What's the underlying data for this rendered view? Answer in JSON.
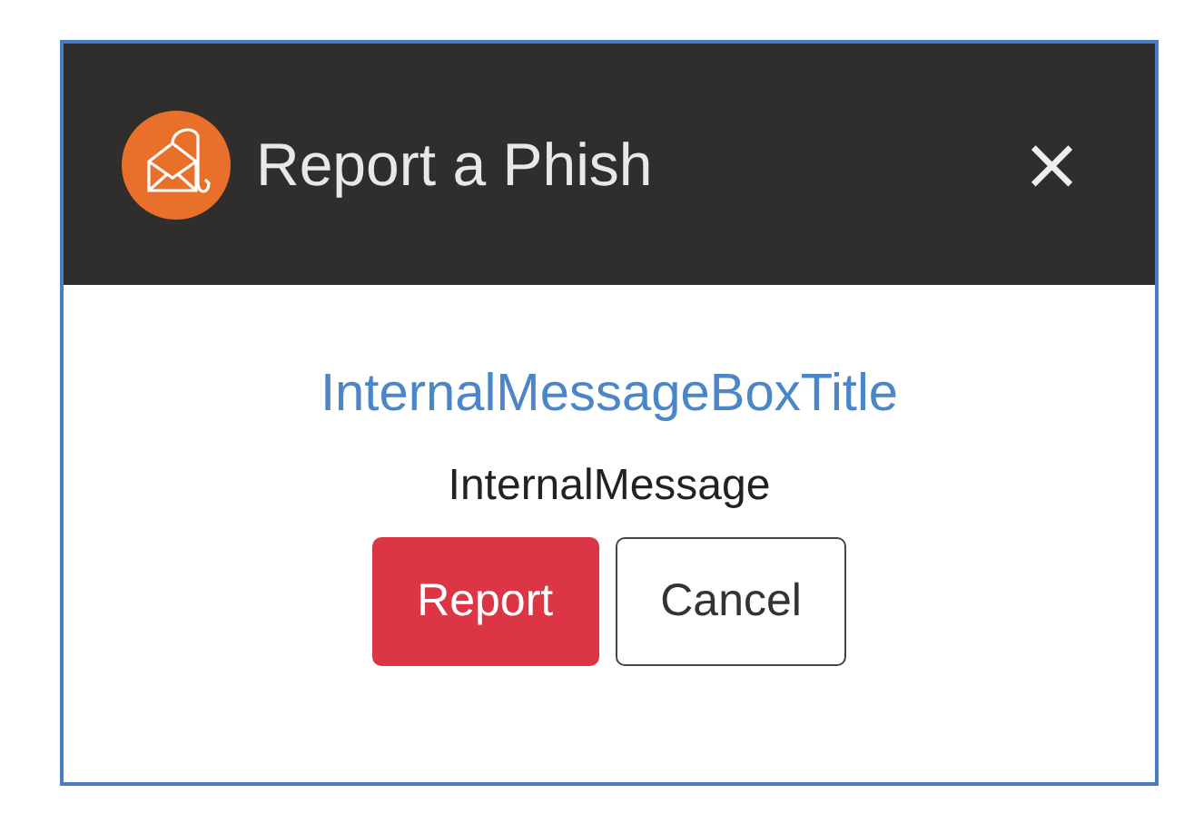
{
  "window": {
    "title": "Report a Phish",
    "close": "×"
  },
  "message": {
    "title": "InternalMessageBoxTitle",
    "body": "InternalMessage"
  },
  "buttons": [
    {
      "label": "Report",
      "kind": "primary"
    },
    {
      "label": "Cancel",
      "kind": "secondary"
    }
  ]
}
